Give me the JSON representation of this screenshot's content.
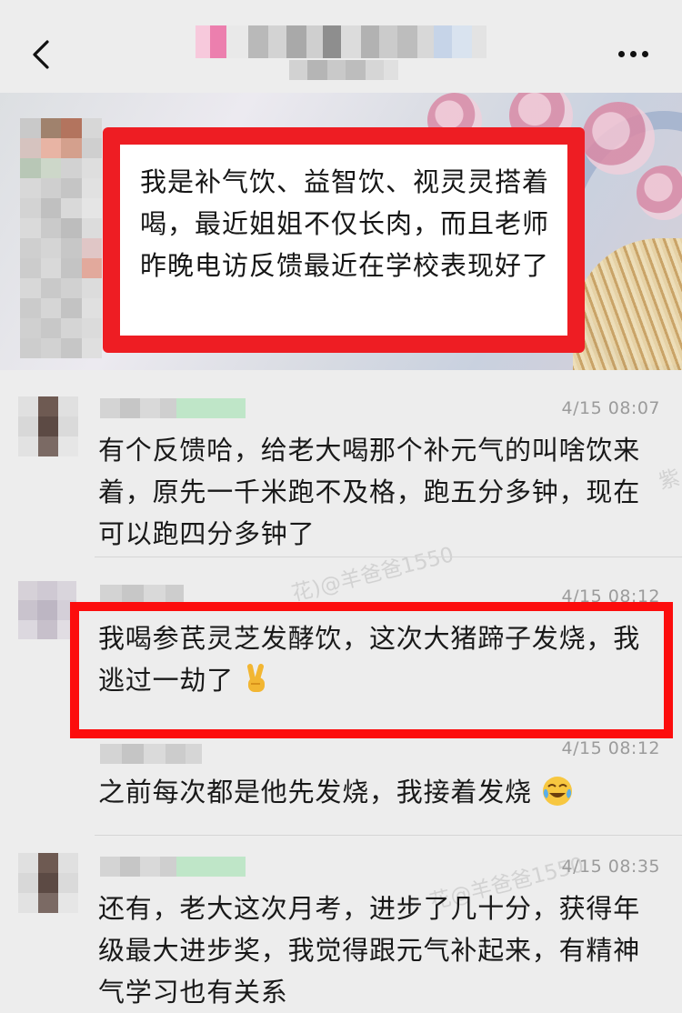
{
  "pinned": {
    "text": "我是补气饮、益智饮、视灵灵搭着喝，最近姐姐不仅长肉，而且老师昨晚电访反馈最近在学校表现好了"
  },
  "messages": [
    {
      "time": "4/15 08:07",
      "text": "有个反馈哈，给老大喝那个补元气的叫啥饮来着，原先一千米跑不及格，跑五分多钟，现在可以跑四分多钟了"
    },
    {
      "time": "4/15 08:12",
      "text": "我喝参芪灵芝发酵饮，这次大猪蹄子发烧，我逃过一劫了",
      "emoji": "victory-hand"
    },
    {
      "time": "4/15 08:12",
      "text": "之前每次都是他先发烧，我接着发烧",
      "emoji": "laughing-crying-face"
    },
    {
      "time": "4/15 08:35",
      "text": "还有，老大这次月考，进步了几十分，获得年级最大进步奖，我觉得跟元气补起来，有精神气学习也有关系"
    }
  ],
  "watermarks": [
    "紫",
    "花)@羊爸爸1550",
    "花@羊爸爸1550"
  ],
  "colors": {
    "background": "#ededed",
    "highlight_red": "#ee1d23",
    "timestamp": "#9b9b9b",
    "text": "#191919"
  }
}
